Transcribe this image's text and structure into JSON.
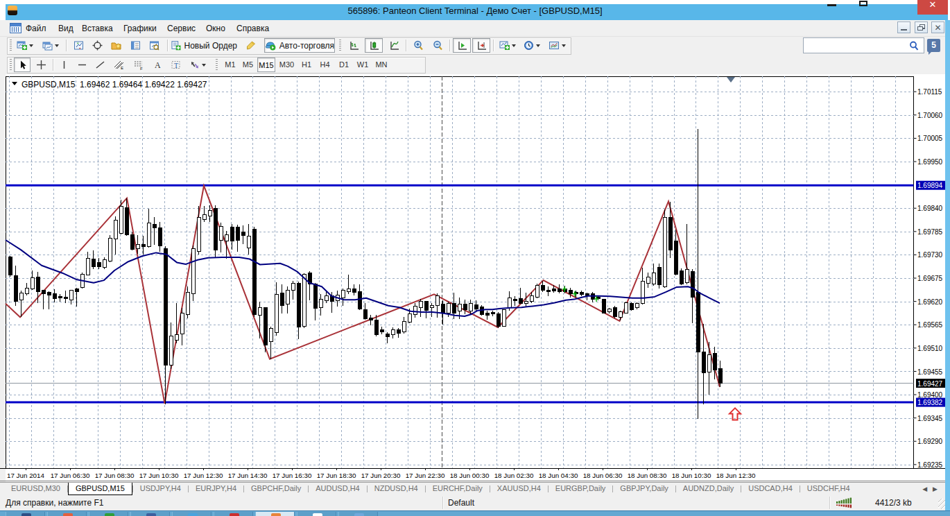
{
  "window": {
    "title": "565896: Panteon Client Terminal - Демо Счет - [GBPUSD,M15]",
    "controls": [
      "minimize",
      "maximize",
      "close"
    ]
  },
  "menu": {
    "items": [
      "Файл",
      "Вид",
      "Вставка",
      "Графики",
      "Сервис",
      "Окно",
      "Справка"
    ],
    "mdi_controls": [
      "minimize",
      "restore",
      "close"
    ]
  },
  "toolbar_standard": {
    "new_order_label": "Новый Ордер",
    "autotrading_label": "Авто-торговля",
    "icons": [
      "new-chart",
      "profiles",
      "tick-chart",
      "cursor-target",
      "favorites",
      "market-watch",
      "data-window",
      "new-order",
      "metaeditor",
      "autotrading",
      "bar-chart",
      "candle-chart",
      "line-chart",
      "zoom-in",
      "zoom-out",
      "auto-scroll",
      "chart-shift",
      "indicators",
      "periods",
      "templates"
    ],
    "pressed": [
      "candle-chart",
      "auto-scroll",
      "chart-shift",
      "autotrading"
    ]
  },
  "search": {
    "placeholder": "",
    "value": "",
    "notification_count": "5"
  },
  "toolbar_tools": {
    "icons": [
      "cursor",
      "crosshair",
      "vertical-line",
      "horizontal-line",
      "trend-line",
      "equidistant-channel",
      "fibonacci",
      "text",
      "text-label",
      "arrows"
    ],
    "pressed": [
      "cursor"
    ],
    "timeframes": [
      "M1",
      "M5",
      "M15",
      "M30",
      "H1",
      "H4",
      "D1",
      "W1",
      "MN"
    ],
    "active_timeframe": "M15"
  },
  "chart_header": {
    "symbol_period": "GBPUSD,M15",
    "quote": "1.69462 1.69464 1.69422 1.69427"
  },
  "chart_data": {
    "type": "candlestick",
    "symbol": "GBPUSD",
    "period": "M15",
    "quote_open": "1.69462",
    "quote_high": "1.69464",
    "quote_low": "1.69422",
    "quote_close": "1.69427",
    "ylim": [
      1.69235,
      1.70115
    ],
    "y_ticks": [
      "1.70115",
      "1.70060",
      "1.70005",
      "1.69950",
      "1.69894",
      "1.69840",
      "1.69785",
      "1.69730",
      "1.69675",
      "1.69620",
      "1.69565",
      "1.69510",
      "1.69455",
      "1.69427",
      "1.69400",
      "1.69382",
      "1.69345",
      "1.69290",
      "1.69235"
    ],
    "x_labels": [
      "17 Jun 2014",
      "17 Jun 06:30",
      "17 Jun 08:30",
      "17 Jun 10:30",
      "17 Jun 12:30",
      "17 Jun 14:30",
      "17 Jun 16:30",
      "17 Jun 18:30",
      "17 Jun 20:30",
      "17 Jun 22:30",
      "18 Jun 00:30",
      "18 Jun 02:30",
      "18 Jun 04:30",
      "18 Jun 06:30",
      "18 Jun 08:30",
      "18 Jun 10:30",
      "18 Jun 12:30"
    ],
    "grid": true,
    "candles_ohlc": [
      [
        1.69725,
        1.69727,
        1.69678,
        1.69682
      ],
      [
        1.69681,
        1.69704,
        1.6961,
        1.6962
      ],
      [
        1.69623,
        1.69646,
        1.69583,
        1.6964
      ],
      [
        1.69638,
        1.69664,
        1.69635,
        1.69651
      ],
      [
        1.6965,
        1.69693,
        1.69648,
        1.69676
      ],
      [
        1.69677,
        1.6969,
        1.69616,
        1.69644
      ],
      [
        1.69647,
        1.69648,
        1.69601,
        1.69638
      ],
      [
        1.69641,
        1.69644,
        1.69602,
        1.69635
      ],
      [
        1.69638,
        1.69649,
        1.69618,
        1.69626
      ],
      [
        1.69631,
        1.69638,
        1.6962,
        1.69628
      ],
      [
        1.6963,
        1.69646,
        1.69616,
        1.69626
      ],
      [
        1.69623,
        1.69648,
        1.69613,
        1.69646
      ],
      [
        1.69649,
        1.69653,
        1.69608,
        1.69644
      ],
      [
        1.69653,
        1.69689,
        1.69651,
        1.69684
      ],
      [
        1.69682,
        1.69738,
        1.69681,
        1.69722
      ],
      [
        1.6972,
        1.6974,
        1.69696,
        1.69702
      ],
      [
        1.69712,
        1.69723,
        1.69697,
        1.69702
      ],
      [
        1.697,
        1.69724,
        1.69696,
        1.69718
      ],
      [
        1.69716,
        1.69776,
        1.69712,
        1.6977
      ],
      [
        1.69768,
        1.6982,
        1.69731,
        1.69811
      ],
      [
        1.69781,
        1.6986,
        1.69778,
        1.69845
      ],
      [
        1.69842,
        1.69864,
        1.69775,
        1.69777
      ],
      [
        1.69777,
        1.69783,
        1.6974,
        1.69743
      ],
      [
        1.69745,
        1.69776,
        1.69732,
        1.69755
      ],
      [
        1.69755,
        1.69775,
        1.69731,
        1.69749
      ],
      [
        1.6975,
        1.69839,
        1.69747,
        1.69806
      ],
      [
        1.69802,
        1.69819,
        1.69753,
        1.69793
      ],
      [
        1.69793,
        1.69808,
        1.69738,
        1.69752
      ],
      [
        1.69744,
        1.6975,
        1.69377,
        1.6947
      ],
      [
        1.69469,
        1.69571,
        1.6946,
        1.69538
      ],
      [
        1.69528,
        1.69616,
        1.69521,
        1.69542
      ],
      [
        1.69544,
        1.69605,
        1.69517,
        1.69593
      ],
      [
        1.6959,
        1.69656,
        1.6958,
        1.69642
      ],
      [
        1.69639,
        1.69752,
        1.69621,
        1.69744
      ],
      [
        1.69738,
        1.69845,
        1.6973,
        1.69819
      ],
      [
        1.69813,
        1.69845,
        1.69807,
        1.69825
      ],
      [
        1.69822,
        1.69847,
        1.69808,
        1.69835
      ],
      [
        1.6984,
        1.69847,
        1.69725,
        1.69742
      ],
      [
        1.69765,
        1.69806,
        1.69736,
        1.69797
      ],
      [
        1.69762,
        1.69787,
        1.69721,
        1.69777
      ],
      [
        1.69795,
        1.69802,
        1.69742,
        1.69763
      ],
      [
        1.69795,
        1.69801,
        1.69738,
        1.69765
      ],
      [
        1.69784,
        1.69799,
        1.69755,
        1.69776
      ],
      [
        1.69747,
        1.69802,
        1.69731,
        1.69774
      ],
      [
        1.69791,
        1.69797,
        1.69583,
        1.69589
      ],
      [
        1.69587,
        1.6962,
        1.69533,
        1.69606
      ],
      [
        1.69605,
        1.69607,
        1.695,
        1.69518
      ],
      [
        1.69526,
        1.69561,
        1.69484,
        1.69556
      ],
      [
        1.69546,
        1.69666,
        1.6954,
        1.69637
      ],
      [
        1.6964,
        1.6966,
        1.69591,
        1.6961
      ],
      [
        1.69614,
        1.69655,
        1.69592,
        1.69647
      ],
      [
        1.69646,
        1.69669,
        1.69624,
        1.69663
      ],
      [
        1.69663,
        1.69667,
        1.69531,
        1.69559
      ],
      [
        1.69562,
        1.69687,
        1.69558,
        1.69684
      ],
      [
        1.69687,
        1.69691,
        1.69622,
        1.69661
      ],
      [
        1.69662,
        1.69664,
        1.69575,
        1.69604
      ],
      [
        1.69605,
        1.69637,
        1.69587,
        1.69625
      ],
      [
        1.69622,
        1.69645,
        1.69616,
        1.69634
      ],
      [
        1.69633,
        1.69643,
        1.69593,
        1.69621
      ],
      [
        1.69622,
        1.69646,
        1.69608,
        1.69635
      ],
      [
        1.69628,
        1.6965,
        1.69609,
        1.69647
      ],
      [
        1.69643,
        1.69683,
        1.69637,
        1.6965
      ],
      [
        1.69649,
        1.6966,
        1.69634,
        1.69641
      ],
      [
        1.69643,
        1.6966,
        1.696,
        1.69602
      ],
      [
        1.69601,
        1.69617,
        1.69577,
        1.6958
      ],
      [
        1.69581,
        1.69588,
        1.69564,
        1.69576
      ],
      [
        1.69576,
        1.69589,
        1.69537,
        1.69541
      ],
      [
        1.69554,
        1.6956,
        1.69542,
        1.69548
      ],
      [
        1.69544,
        1.69548,
        1.69521,
        1.69537
      ],
      [
        1.69541,
        1.69559,
        1.69533,
        1.69553
      ],
      [
        1.69553,
        1.69557,
        1.69535,
        1.69545
      ],
      [
        1.69548,
        1.69584,
        1.69544,
        1.69573
      ],
      [
        1.69572,
        1.69603,
        1.69569,
        1.69591
      ],
      [
        1.6959,
        1.69616,
        1.69582,
        1.69609
      ],
      [
        1.69606,
        1.69626,
        1.69583,
        1.6962
      ],
      [
        1.6962,
        1.69621,
        1.69581,
        1.69599
      ],
      [
        1.69605,
        1.69616,
        1.69583,
        1.69611
      ],
      [
        1.69611,
        1.69639,
        1.69582,
        1.69634
      ],
      [
        1.69613,
        1.69622,
        1.69566,
        1.69594
      ],
      [
        1.69593,
        1.6962,
        1.69584,
        1.69615
      ],
      [
        1.69616,
        1.6964,
        1.69579,
        1.69593
      ],
      [
        1.69598,
        1.69629,
        1.69578,
        1.69614
      ],
      [
        1.69614,
        1.69625,
        1.6959,
        1.696
      ],
      [
        1.69598,
        1.69625,
        1.69588,
        1.69616
      ],
      [
        1.69612,
        1.69623,
        1.69598,
        1.69603
      ],
      [
        1.69607,
        1.69611,
        1.69587,
        1.6959
      ],
      [
        1.69592,
        1.69598,
        1.69577,
        1.69588
      ],
      [
        1.69594,
        1.69599,
        1.69585,
        1.6959
      ],
      [
        1.69591,
        1.69595,
        1.69558,
        1.69561
      ],
      [
        1.69561,
        1.69601,
        1.6956,
        1.69601
      ],
      [
        1.69606,
        1.69644,
        1.69599,
        1.69628
      ],
      [
        1.69626,
        1.69632,
        1.69609,
        1.69622
      ],
      [
        1.69627,
        1.69652,
        1.69614,
        1.69616
      ],
      [
        1.69616,
        1.6964,
        1.69606,
        1.69621
      ],
      [
        1.6962,
        1.69642,
        1.69616,
        1.69634
      ],
      [
        1.6963,
        1.69662,
        1.69628,
        1.69658
      ],
      [
        1.69658,
        1.69669,
        1.69642,
        1.69646
      ],
      [
        1.69647,
        1.69655,
        1.69633,
        1.69643
      ],
      [
        1.6965,
        1.69658,
        1.69641,
        1.69645
      ],
      [
        1.6965,
        1.69661,
        1.69639,
        1.69643
      ],
      [
        1.69649,
        1.69657,
        1.69639,
        1.69643
      ],
      [
        1.69646,
        1.69653,
        1.6963,
        1.69639
      ],
      [
        1.69642,
        1.69645,
        1.6963,
        1.69638
      ],
      [
        1.69642,
        1.69646,
        1.69632,
        1.69636
      ],
      [
        1.69638,
        1.69641,
        1.69622,
        1.69634
      ],
      [
        1.69639,
        1.69642,
        1.69618,
        1.69625
      ],
      [
        1.6963,
        1.69633,
        1.69623,
        1.69627
      ],
      [
        1.69625,
        1.69626,
        1.69592,
        1.69593
      ],
      [
        1.69596,
        1.69605,
        1.69591,
        1.69602
      ],
      [
        1.69605,
        1.69609,
        1.6958,
        1.69585
      ],
      [
        1.69583,
        1.69599,
        1.69575,
        1.69596
      ],
      [
        1.69593,
        1.6962,
        1.69591,
        1.69617
      ],
      [
        1.69615,
        1.69618,
        1.69599,
        1.69601
      ],
      [
        1.69605,
        1.69618,
        1.69602,
        1.69616
      ],
      [
        1.69616,
        1.69699,
        1.69613,
        1.69667
      ],
      [
        1.69663,
        1.69688,
        1.69653,
        1.69677
      ],
      [
        1.69661,
        1.6971,
        1.69657,
        1.69688
      ],
      [
        1.69701,
        1.69709,
        1.69651,
        1.69659
      ],
      [
        1.69655,
        1.69837,
        1.69653,
        1.69819
      ],
      [
        1.69818,
        1.69855,
        1.69723,
        1.69742
      ],
      [
        1.69763,
        1.69789,
        1.69682,
        1.69685
      ],
      [
        1.69693,
        1.69698,
        1.69659,
        1.69661
      ],
      [
        1.69664,
        1.69803,
        1.69661,
        1.69695
      ],
      [
        1.69691,
        1.69696,
        1.69569,
        1.69631
      ],
      [
        1.69641,
        1.70027,
        1.69343,
        1.69501
      ],
      [
        1.69501,
        1.69567,
        1.69377,
        1.69452
      ],
      [
        1.69454,
        1.69525,
        1.69401,
        1.69495
      ],
      [
        1.69498,
        1.69513,
        1.69437,
        1.69459
      ],
      [
        1.69461,
        1.6948,
        1.69418,
        1.69427
      ]
    ],
    "ma_line": {
      "name": "moving-average",
      "color": "#000080",
      "points": [
        [
          8,
          1.69765
        ],
        [
          30,
          1.69742
        ],
        [
          60,
          1.69705
        ],
        [
          90,
          1.69687
        ],
        [
          110,
          1.69672
        ],
        [
          135,
          1.69664
        ],
        [
          150,
          1.6967
        ],
        [
          165,
          1.69693
        ],
        [
          185,
          1.69714
        ],
        [
          205,
          1.69727
        ],
        [
          225,
          1.69735
        ],
        [
          240,
          1.69731
        ],
        [
          255,
          1.69712
        ],
        [
          268,
          1.69708
        ],
        [
          285,
          1.69718
        ],
        [
          300,
          1.69723
        ],
        [
          320,
          1.69724
        ],
        [
          345,
          1.69724
        ],
        [
          360,
          1.6972
        ],
        [
          375,
          1.69707
        ],
        [
          404,
          1.6971
        ],
        [
          415,
          1.69703
        ],
        [
          429,
          1.6969
        ],
        [
          446,
          1.69664
        ],
        [
          464,
          1.69655
        ],
        [
          478,
          1.69633
        ],
        [
          496,
          1.69624
        ],
        [
          512,
          1.69624
        ],
        [
          528,
          1.69628
        ],
        [
          544,
          1.69619
        ],
        [
          560,
          1.6961
        ],
        [
          576,
          1.69606
        ],
        [
          592,
          1.69597
        ],
        [
          608,
          1.69595
        ],
        [
          624,
          1.69595
        ],
        [
          640,
          1.69592
        ],
        [
          656,
          1.69587
        ],
        [
          670,
          1.69585
        ],
        [
          680,
          1.6959
        ],
        [
          688,
          1.69598
        ],
        [
          700,
          1.69601
        ],
        [
          710,
          1.69601
        ],
        [
          720,
          1.69603
        ],
        [
          736,
          1.69605
        ],
        [
          752,
          1.69606
        ],
        [
          768,
          1.69609
        ],
        [
          784,
          1.69612
        ],
        [
          800,
          1.69617
        ],
        [
          816,
          1.69623
        ],
        [
          828,
          1.69625
        ],
        [
          840,
          1.6963
        ],
        [
          848,
          1.69633
        ],
        [
          864,
          1.69633
        ],
        [
          880,
          1.69632
        ],
        [
          896,
          1.6963
        ],
        [
          912,
          1.69628
        ],
        [
          928,
          1.69628
        ],
        [
          944,
          1.69631
        ],
        [
          960,
          1.69642
        ],
        [
          976,
          1.69654
        ],
        [
          992,
          1.69655
        ],
        [
          1000,
          1.69651
        ],
        [
          1008,
          1.69641
        ],
        [
          1022,
          1.69629
        ],
        [
          1038,
          1.69616
        ]
      ]
    },
    "zigzag": {
      "name": "zigzag",
      "color": "#A93238",
      "points": [
        [
          8,
          1.69615
        ],
        [
          29,
          1.69583
        ],
        [
          183,
          1.69864
        ],
        [
          237.5,
          1.69379
        ],
        [
          294,
          1.69893
        ],
        [
          389,
          1.69484
        ],
        [
          626,
          1.69637
        ],
        [
          718,
          1.69559
        ],
        [
          783.5,
          1.6967
        ],
        [
          893.5,
          1.69574
        ],
        [
          964,
          1.69856
        ],
        [
          1038,
          1.69418
        ]
      ]
    },
    "hlines": [
      {
        "price": 1.69894,
        "label": "1.69894",
        "color": "#0000C8",
        "width": 3,
        "type": "resistance"
      },
      {
        "price": 1.69382,
        "label": "1.69382",
        "color": "#0000C8",
        "width": 3,
        "type": "support"
      },
      {
        "price": 1.69427,
        "label": "1.69427",
        "color": "#8C959E",
        "width": 1,
        "type": "bid"
      }
    ],
    "day_separator_x": 637,
    "green_marks": [
      [
        814,
        1.69649
      ],
      [
        829,
        1.69638
      ],
      [
        860,
        1.69626
      ]
    ],
    "red_arrow": {
      "x": 1060,
      "price": 1.69352
    },
    "bar_marker_x": 1054
  },
  "tabs": {
    "items": [
      "EURUSD,M30",
      "GBPUSD,M15",
      "USDJPY,H4",
      "EURJPY,H4",
      "GBPCHF,Daily",
      "AUDUSD,H4",
      "NZDUSD,H4",
      "EURCHF,Daily",
      "XAUUSD,H4",
      "EURGBP,Daily",
      "GBPJPY,Daily",
      "AUDNZD,Daily",
      "USDCAD,H4",
      "USDCHF,H4"
    ],
    "active": "GBPUSD,M15"
  },
  "statusbar": {
    "help_text": "Для справки, нажмите F1",
    "profile": "Default",
    "traffic": "4412/3 kb"
  },
  "taskbar": {
    "buttons": [
      "app1",
      "app2",
      "app3",
      "app4",
      "app5",
      "app6",
      "app7-active",
      "app8",
      "app9"
    ]
  }
}
